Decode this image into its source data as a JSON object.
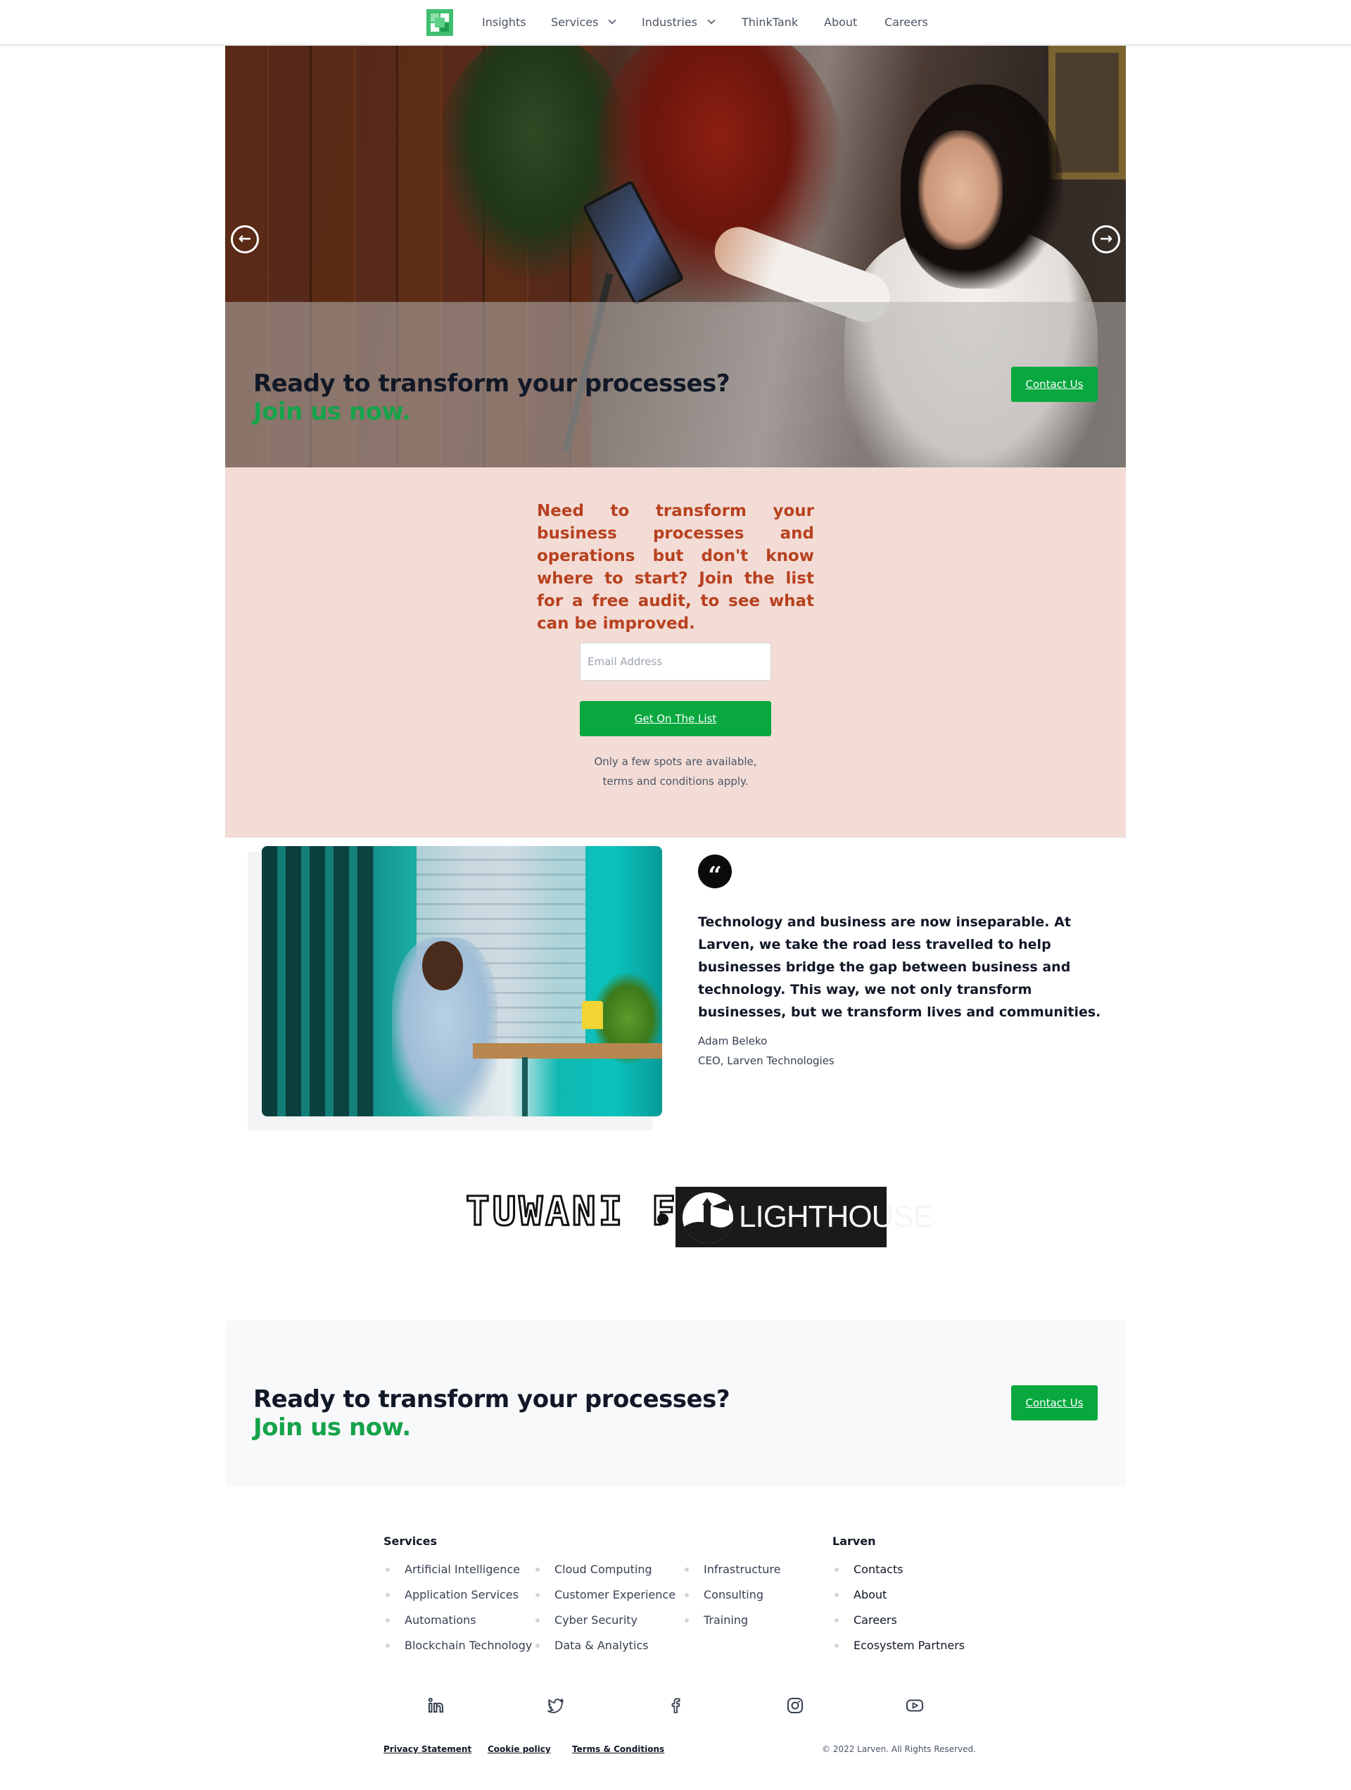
{
  "colors": {
    "brand_green": "#08a83f",
    "accent_green": "#16a34a",
    "audit_bg": "#f3dcd6",
    "audit_text": "#b8411f",
    "cta_bg": "#f8f9fb"
  },
  "nav": {
    "logo_icon": "larven-logo",
    "links": [
      {
        "label": "Insights",
        "dropdown": false
      },
      {
        "label": "Services",
        "dropdown": true
      },
      {
        "label": "Industries",
        "dropdown": true
      },
      {
        "label": "ThinkTank",
        "dropdown": false
      },
      {
        "label": "About",
        "dropdown": false
      },
      {
        "label": "Careers",
        "dropdown": false
      }
    ]
  },
  "hero": {
    "title": "Ready to transform your processes?",
    "subtitle": "Join us now.",
    "cta_label": "Contact Us",
    "prev_icon": "arrow-left-circle-icon",
    "next_icon": "arrow-right-circle-icon"
  },
  "audit": {
    "text": "Need to transform your business processes and operations but don't know where to start? Join the list for a free audit, to see what can be improved.",
    "email_placeholder": "Email Address",
    "button_label": "Get On The List",
    "note_line1": "Only a few spots are available,",
    "note_line2": "terms and conditions apply."
  },
  "testimonial": {
    "quote_icon": "quote-icon",
    "text": "Technology and business are now inseparable. At Larven, we take the road less travelled to help businesses bridge the gap between business and technology. This way, we not only transform businesses, but we transform lives and communities.",
    "name": "Adam Beleko",
    "role": "CEO, Larven Technologies"
  },
  "partners": [
    {
      "name": "TUWANI F",
      "logo": "tuwani-logo"
    },
    {
      "name": "LIGHTHOUSE",
      "logo": "lighthouse-logo"
    }
  ],
  "cta": {
    "title": "Ready to transform your processes?",
    "subtitle": "Join us now.",
    "button_label": "Contact Us"
  },
  "footer": {
    "services_heading": "Services",
    "services_col1": [
      "Artificial Intelligence",
      "Application Services",
      "Automations",
      "Blockchain Technology"
    ],
    "services_col2": [
      "Cloud Computing",
      "Customer Experience",
      "Cyber Security",
      "Data & Analytics"
    ],
    "services_col3": [
      "Infrastructure",
      "Consulting",
      "Training"
    ],
    "larven_heading": "Larven",
    "larven_links": [
      "Contacts",
      "About",
      "Careers",
      "Ecosystem Partners"
    ],
    "social_icons": [
      "linkedin-icon",
      "twitter-icon",
      "facebook-icon",
      "instagram-icon",
      "youtube-icon"
    ],
    "legal_links": [
      "Privacy Statement",
      "Cookie policy",
      "Terms & Conditions"
    ],
    "copyright": "© 2022 Larven. All Rights Reserved."
  }
}
